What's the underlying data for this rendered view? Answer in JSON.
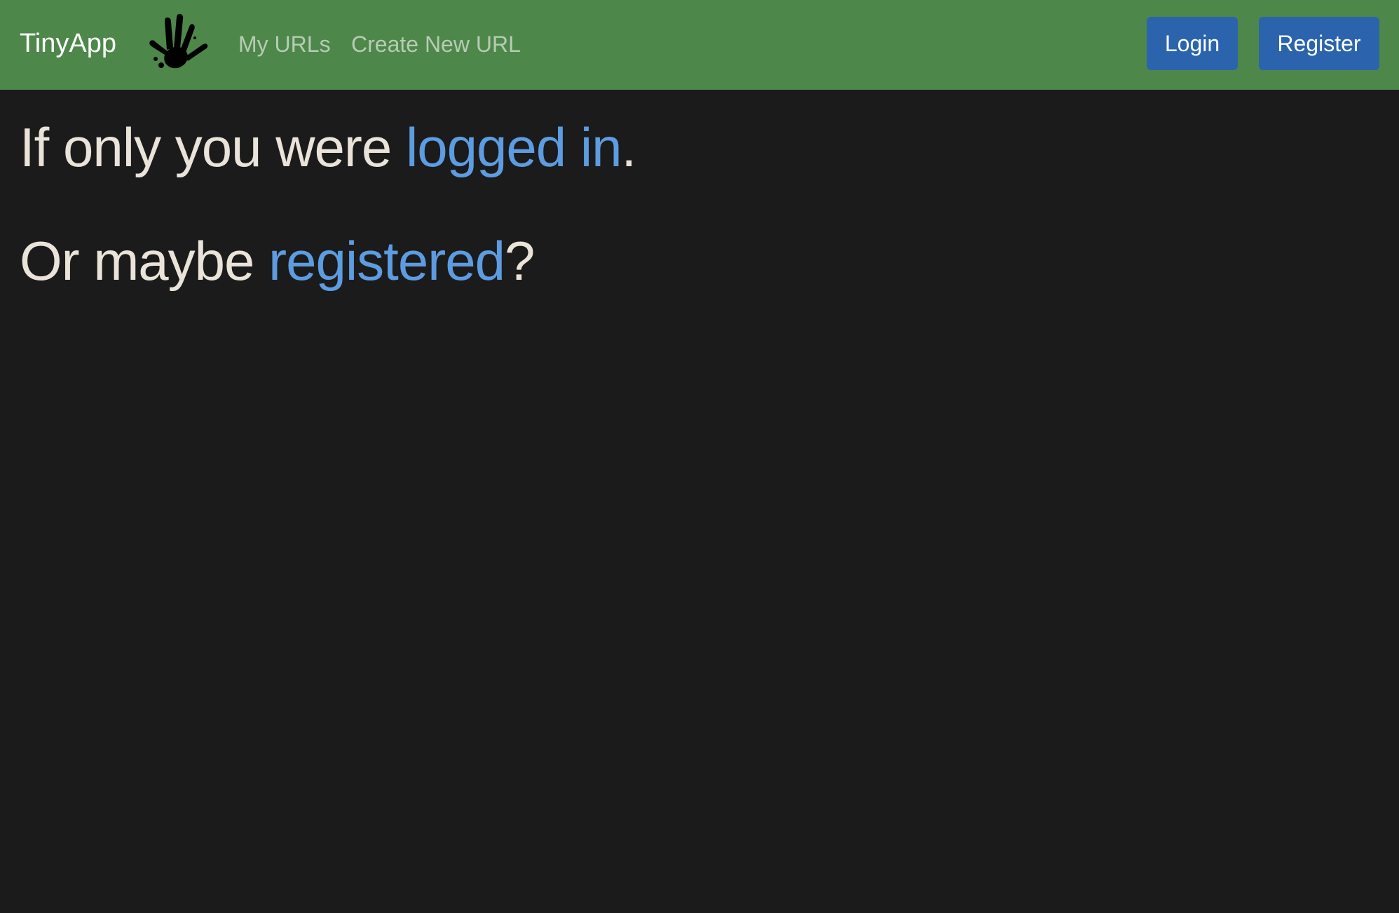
{
  "navbar": {
    "brand": "TinyApp",
    "logo_icon": "hand-print-icon",
    "links": {
      "my_urls": "My URLs",
      "create_new_url": "Create New URL"
    },
    "buttons": {
      "login": "Login",
      "register": "Register"
    }
  },
  "main": {
    "line1": {
      "prefix": "If only you were ",
      "link": "logged in",
      "suffix": "."
    },
    "line2": {
      "prefix": "Or maybe ",
      "link": "registered",
      "suffix": "?"
    }
  },
  "colors": {
    "navbar_bg": "#4e874a",
    "page_bg": "#1b1b1b",
    "button_bg": "#2b64ad",
    "link": "#5d9ce0",
    "text": "#eae3d9"
  }
}
